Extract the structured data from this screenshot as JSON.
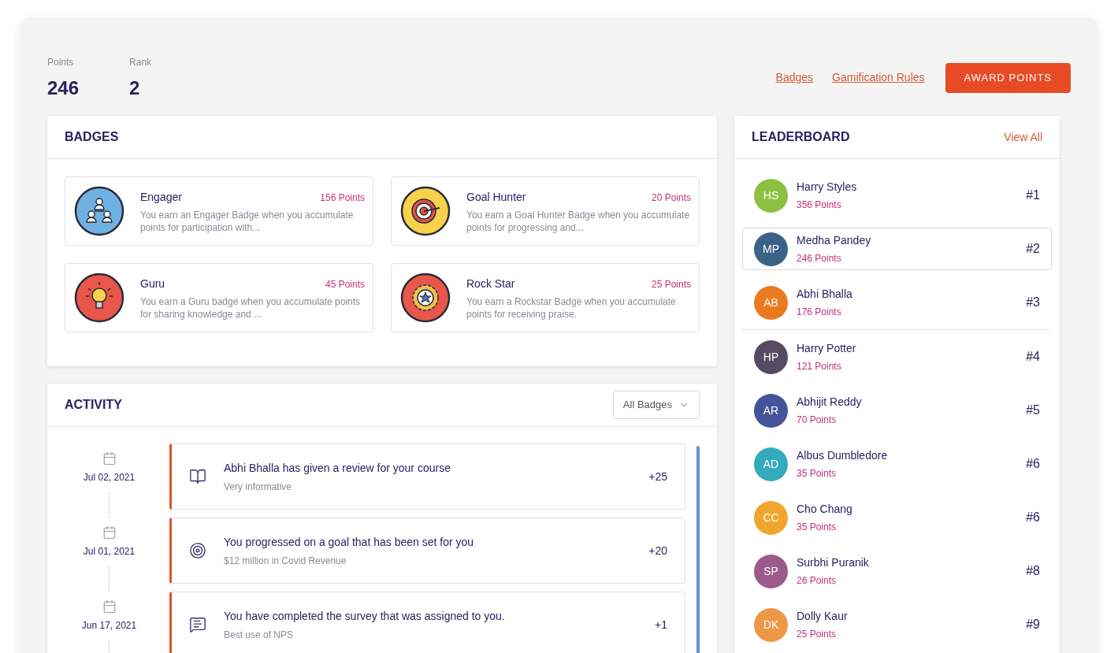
{
  "stats": [
    {
      "label": "Points",
      "value": "246"
    },
    {
      "label": "Rank",
      "value": "2"
    }
  ],
  "links": [
    "Badges",
    "Gamification Rules"
  ],
  "award_button": "AWARD POINTS",
  "badges": {
    "title": "BADGES",
    "items": [
      {
        "kind": "engager",
        "name": "Engager",
        "points": "156 Points",
        "description": "You earn an Engager Badge when you accumulate points for participation with..."
      },
      {
        "kind": "goal",
        "name": "Goal Hunter",
        "points": "20 Points",
        "description": "You earn a Goal Hunter Badge when you accumulate points for progressing and..."
      },
      {
        "kind": "guru",
        "name": "Guru",
        "points": "45 Points",
        "description": "You earn a Guru badge when you accumulate points for sharing knowledge and ..."
      },
      {
        "kind": "rockstar",
        "name": "Rock Star",
        "points": "25 Points",
        "description": "You earn a Rockstar Badge when you accumulate points for receiving praise."
      }
    ]
  },
  "activity": {
    "title": "ACTIVITY",
    "filter": "All Badges",
    "items": [
      {
        "kind": "review",
        "date": "Jul 02, 2021",
        "title": "Abhi Bhalla has given a review for your course",
        "subtitle": "Very informative",
        "points": "+25"
      },
      {
        "kind": "goal",
        "date": "Jul 01, 2021",
        "title": "You progressed on a goal that has been set for you",
        "subtitle": "$12 million in Covid Revenue",
        "points": "+20"
      },
      {
        "kind": "survey",
        "date": "Jun 17, 2021",
        "title": "You have completed the survey that was assigned to you.",
        "subtitle": "Best use of NPS",
        "points": "+1"
      }
    ]
  },
  "leaderboard": {
    "title": "LEADERBOARD",
    "view_all": "View All",
    "rows": [
      {
        "initials": "HS",
        "color": "#8cc043",
        "name": "Harry Styles",
        "points": "356 Points",
        "rank": "#1",
        "selected": false
      },
      {
        "initials": "MP",
        "color": "#3a6186",
        "name": "Medha Pandey",
        "points": "246 Points",
        "rank": "#2",
        "selected": true
      },
      {
        "initials": "AB",
        "color": "#ea7a1e",
        "name": "Abhi Bhalla",
        "points": "176 Points",
        "rank": "#3",
        "selected": false
      },
      {
        "initials": "HP",
        "color": "#574b63",
        "name": "Harry Potter",
        "points": "121 Points",
        "rank": "#4",
        "selected": false
      },
      {
        "initials": "AR",
        "color": "#44539a",
        "name": "Abhijit Reddy",
        "points": "70 Points",
        "rank": "#5",
        "selected": false
      },
      {
        "initials": "AD",
        "color": "#33abbd",
        "name": "Albus Dumbledore",
        "points": "35 Points",
        "rank": "#6",
        "selected": false
      },
      {
        "initials": "CC",
        "color": "#f0a62e",
        "name": "Cho Chang",
        "points": "35 Points",
        "rank": "#6",
        "selected": false
      },
      {
        "initials": "SP",
        "color": "#9b5a8a",
        "name": "Surbhi Puranik",
        "points": "26 Points",
        "rank": "#8",
        "selected": false
      },
      {
        "initials": "DK",
        "color": "#ec9846",
        "name": "Dolly Kaur",
        "points": "25 Points",
        "rank": "#9",
        "selected": false
      }
    ]
  }
}
